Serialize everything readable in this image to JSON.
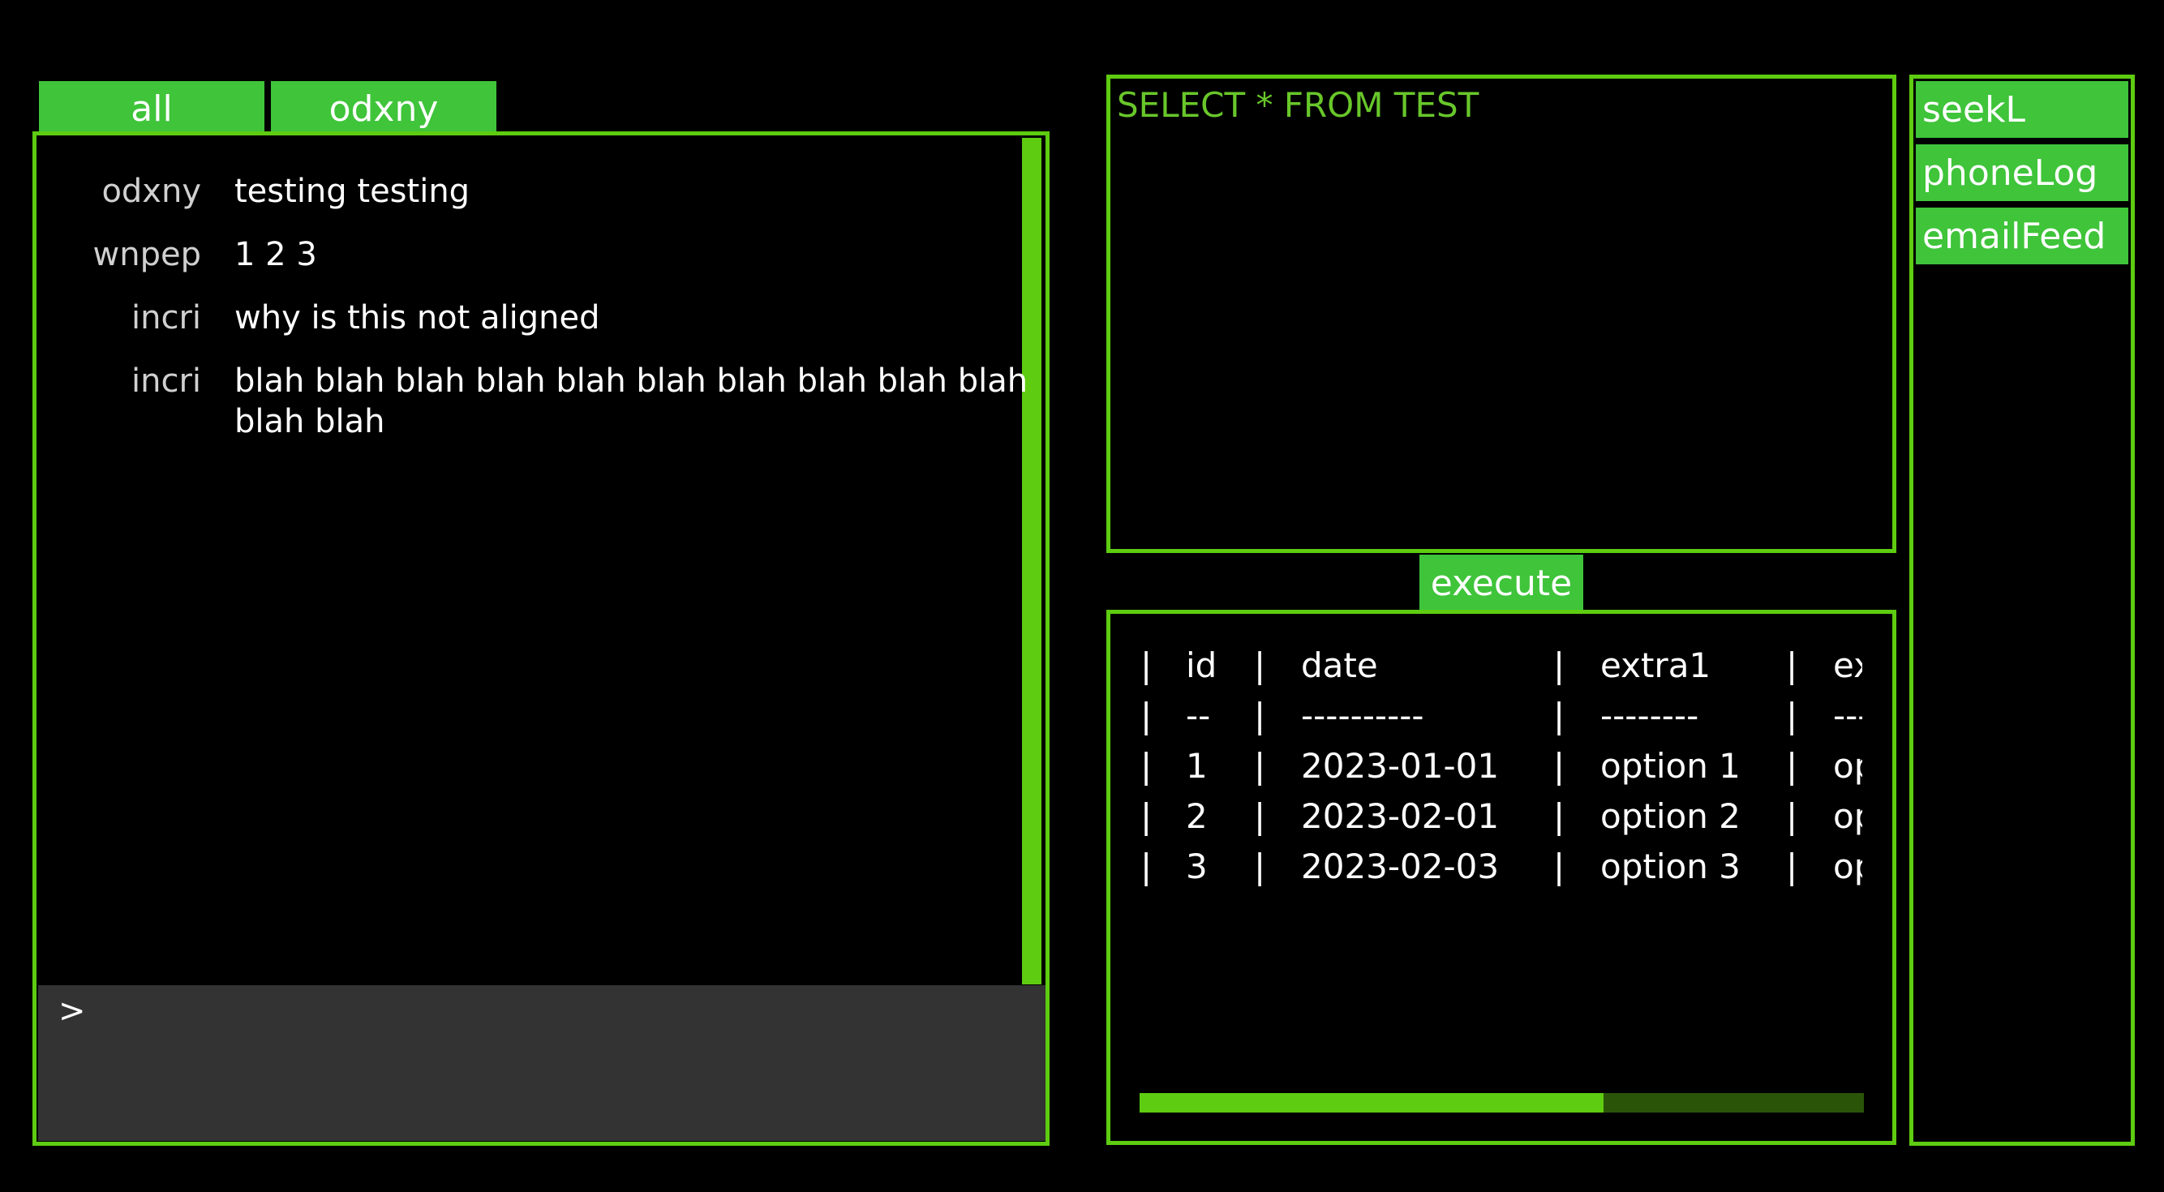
{
  "tabs": [
    "all",
    "odxny"
  ],
  "chat": {
    "messages": [
      {
        "user": "odxny",
        "text": "testing testing"
      },
      {
        "user": "wnpep",
        "text": "1 2 3"
      },
      {
        "user": "incri",
        "text": "why is this not aligned"
      },
      {
        "user": "incri",
        "text": "blah blah blah blah blah blah blah blah blah blah blah blah"
      }
    ],
    "prompt": ">"
  },
  "query": {
    "text": "SELECT * FROM TEST",
    "execute_label": "execute"
  },
  "results": {
    "columns": [
      "id",
      "date",
      "extra1",
      "ex"
    ],
    "separator": [
      "--",
      "----------",
      "--------",
      "---"
    ],
    "rows": [
      [
        "1",
        "2023-01-01",
        "option 1",
        "op"
      ],
      [
        "2",
        "2023-02-01",
        "option 2",
        "op"
      ],
      [
        "3",
        "2023-02-03",
        "option 3",
        "op"
      ]
    ],
    "horizontal_scroll_fraction": 0.64
  },
  "feeds": [
    "seekL",
    "phoneLog",
    "emailFeed"
  ],
  "colors": {
    "accent": "#5ecc11",
    "button": "#3fc43a",
    "query_text": "#68c72a",
    "input_bg": "#333333"
  }
}
